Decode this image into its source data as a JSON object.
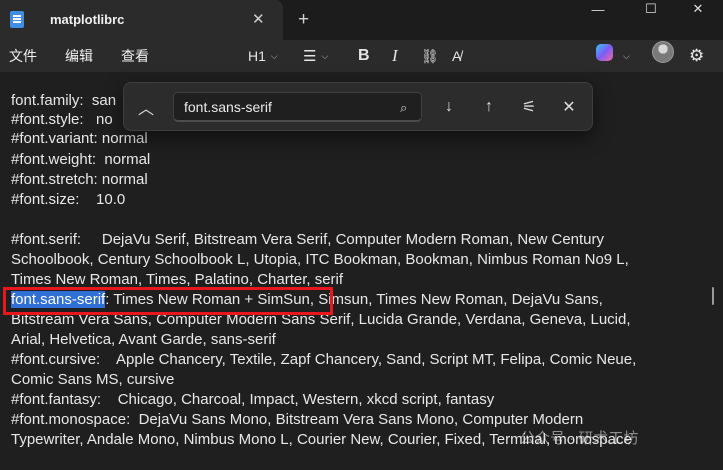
{
  "window": {
    "tab_title": "matplotlibrc",
    "tab_close": "✕",
    "new_tab": "+",
    "minimize": "—",
    "maximize": "☐",
    "close": "✕"
  },
  "menu": {
    "file": "文件",
    "edit": "编辑",
    "view": "查看"
  },
  "toolbar": {
    "heading": "H1",
    "list_icon": "☰",
    "bold": "B",
    "italic": "I",
    "link_icon": "⛓",
    "clear_format": "A̸",
    "chevron": "⌵",
    "settings_icon": "⚙"
  },
  "find": {
    "query": "font.sans-serif",
    "up_icon": "︿",
    "search_icon": "⌕",
    "next_icon": "↓",
    "prev_icon": "↑",
    "options_icon": "⚟",
    "close_icon": "✕"
  },
  "doc": {
    "lines": [
      "font.family:  san",
      "#font.style:   no",
      "#font.variant: normal",
      "#font.weight:  normal",
      "#font.stretch: normal",
      "#font.size:    10.0",
      "",
      "#font.serif:     DejaVu Serif, Bitstream Vera Serif, Computer Modern Roman, New Century",
      "Schoolbook, Century Schoolbook L, Utopia, ITC Bookman, Bookman, Nimbus Roman No9 L,",
      "Times New Roman, Times, Palatino, Charter, serif",
      "",
      "Bitstream Vera Sans, Computer Modern Sans Serif, Lucida Grande, Verdana, Geneva, Lucid,",
      "Arial, Helvetica, Avant Garde, sans-serif",
      "#font.cursive:    Apple Chancery, Textile, Zapf Chancery, Sand, Script MT, Felipa, Comic Neue,",
      "Comic Sans MS, cursive",
      "#font.fantasy:    Chicago, Charcoal, Impact, Western, xkcd script, fantasy",
      "#font.monospace:  DejaVu Sans Mono, Bitstream Vera Sans Mono, Computer Modern",
      "Typewriter, Andale Mono, Nimbus Mono L, Courier New, Courier, Fixed, Terminal, monospace"
    ],
    "match_text": "font.sans-serif",
    "match_rest": ": Times New Roman + SimSun",
    "match_tail": ", Simsun, Times New Roman, DejaVu Sans,"
  },
  "watermark": "公众号 · 研术工坊"
}
